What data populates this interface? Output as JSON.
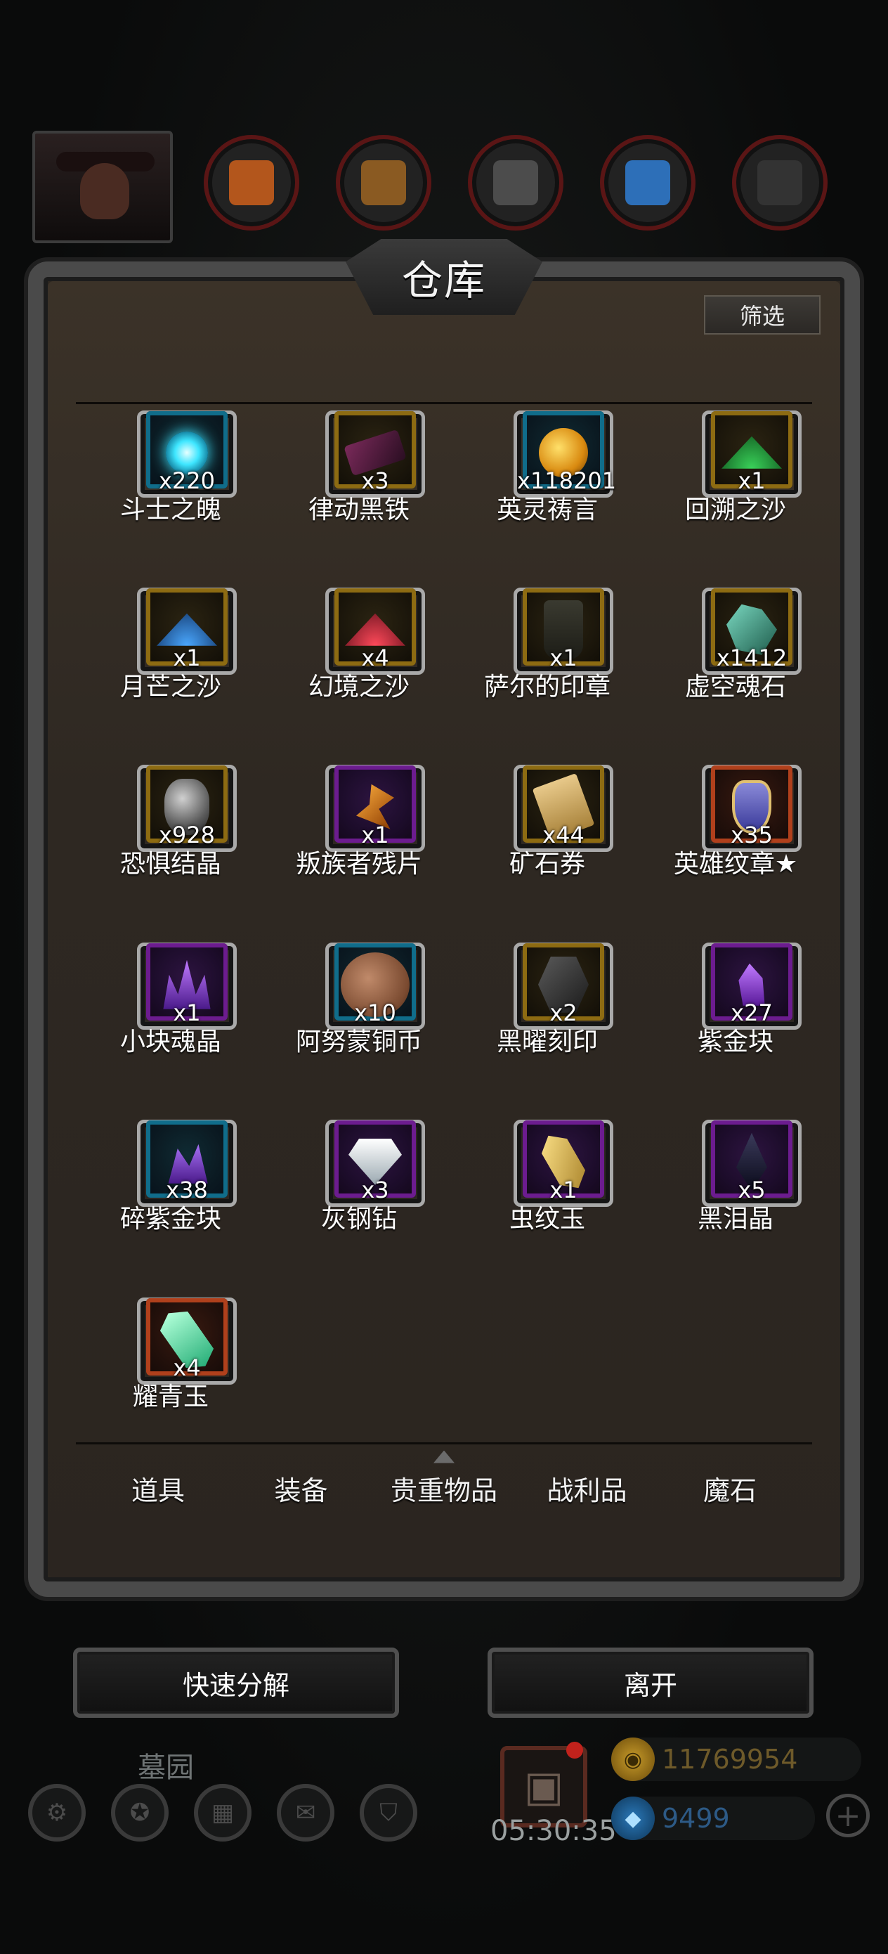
{
  "window": {
    "title": "仓库",
    "filter_label": "筛选"
  },
  "items": [
    {
      "name": "斗士之魄",
      "count": "x220",
      "rarity": "blue",
      "icon": "blue-soul-orb-icon"
    },
    {
      "name": "律动黑铁",
      "count": "x3",
      "rarity": "gold",
      "icon": "dark-iron-ingot-icon"
    },
    {
      "name": "英灵祷言",
      "count": "x118201",
      "rarity": "blue",
      "icon": "golden-orb-icon"
    },
    {
      "name": "回溯之沙",
      "count": "x1",
      "rarity": "gold",
      "icon": "green-sand-pile-icon"
    },
    {
      "name": "月芒之沙",
      "count": "x1",
      "rarity": "gold",
      "icon": "blue-sand-pile-icon"
    },
    {
      "name": "幻境之沙",
      "count": "x4",
      "rarity": "gold",
      "icon": "red-sand-pile-icon"
    },
    {
      "name": "萨尔的印章",
      "count": "x1",
      "rarity": "gold",
      "icon": "tabard-seal-icon"
    },
    {
      "name": "虚空魂石",
      "count": "x1412",
      "rarity": "gold",
      "icon": "void-crystal-icon"
    },
    {
      "name": "恐惧结晶",
      "count": "x928",
      "rarity": "gold",
      "icon": "fear-crystal-icon"
    },
    {
      "name": "叛族者残片",
      "count": "x1",
      "rarity": "purple",
      "icon": "traitor-fragment-icon"
    },
    {
      "name": "矿石券",
      "count": "x44",
      "rarity": "gold",
      "icon": "scroll-ticket-icon"
    },
    {
      "name": "英雄纹章★",
      "count": "x35",
      "rarity": "red",
      "icon": "hero-emblem-icon"
    },
    {
      "name": "小块魂晶",
      "count": "x1",
      "rarity": "purple",
      "icon": "purple-crystal-cluster-icon"
    },
    {
      "name": "阿努蒙铜币",
      "count": "x10",
      "rarity": "blue",
      "icon": "copper-coin-icon"
    },
    {
      "name": "黑曜刻印",
      "count": "x2",
      "rarity": "gold",
      "icon": "obsidian-seal-icon"
    },
    {
      "name": "紫金块",
      "count": "x27",
      "rarity": "purple",
      "icon": "purple-gold-chunk-icon"
    },
    {
      "name": "碎紫金块",
      "count": "x38",
      "rarity": "blue",
      "icon": "purple-shard-icon"
    },
    {
      "name": "灰钢钻",
      "count": "x3",
      "rarity": "purple",
      "icon": "diamond-icon"
    },
    {
      "name": "虫纹玉",
      "count": "x1",
      "rarity": "purple",
      "icon": "insect-jade-icon"
    },
    {
      "name": "黑泪晶",
      "count": "x5",
      "rarity": "purple",
      "icon": "black-tear-gem-icon"
    },
    {
      "name": "耀青玉",
      "count": "x4",
      "rarity": "red",
      "icon": "green-jade-crystal-icon"
    }
  ],
  "tabs": [
    {
      "label": "道具",
      "active": false
    },
    {
      "label": "装备",
      "active": false
    },
    {
      "label": "贵重物品",
      "active": true
    },
    {
      "label": "战利品",
      "active": false
    },
    {
      "label": "魔石",
      "active": false
    }
  ],
  "actions": {
    "disassemble_label": "快速分解",
    "leave_label": "离开"
  },
  "hud": {
    "zone": "墓园",
    "timer": "05:30:35",
    "gold": "11769954",
    "gems": "9499"
  },
  "colors": {
    "gold_frame": "#8d6b12",
    "blue_frame": "#106d8b",
    "purple_frame": "#6c1c8f",
    "red_frame": "#b0401c",
    "panel_bg": "#2e2822"
  }
}
